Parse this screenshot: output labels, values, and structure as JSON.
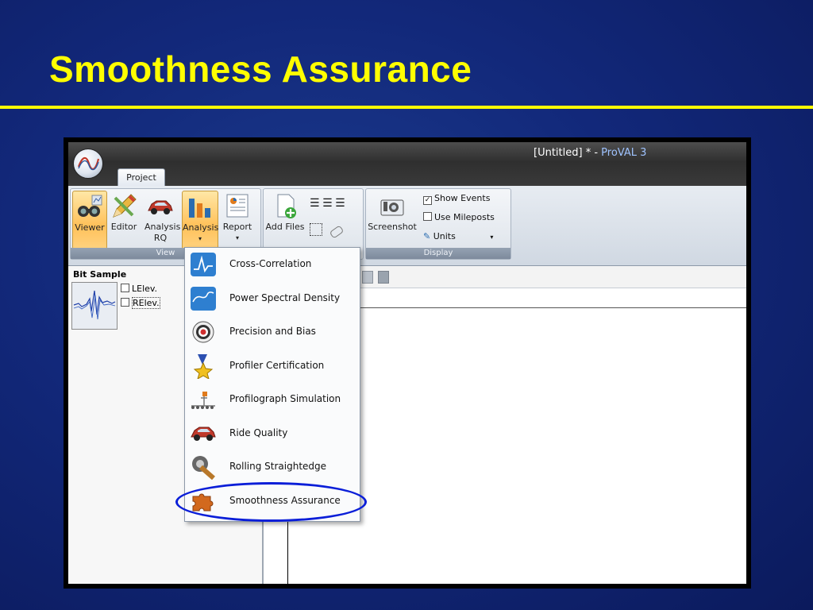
{
  "slide": {
    "title": "Smoothness Assurance"
  },
  "window": {
    "title_prefix": "[Untitled] * - ",
    "app_name": "ProVAL 3"
  },
  "ribbon": {
    "tabs": [
      {
        "label": "Project"
      }
    ],
    "view_group": {
      "label": "View",
      "buttons": [
        {
          "label": "Viewer",
          "icon": "viewer-icon",
          "active": true
        },
        {
          "label": "Editor",
          "icon": "editor-icon"
        },
        {
          "label": "Analysis RQ",
          "icon": "car-icon"
        },
        {
          "label": "Analysis",
          "icon": "bar-chart-icon",
          "dropdown": true,
          "active": true
        },
        {
          "label": "Report",
          "icon": "report-icon",
          "dropdown": true
        }
      ]
    },
    "file_group": {
      "add_files_label": "Add Files"
    },
    "display_group": {
      "label": "Display",
      "screenshot_label": "Screenshot",
      "show_events": {
        "label": "Show Events",
        "checked": true
      },
      "use_mileposts": {
        "label": "Use Mileposts",
        "checked": false
      },
      "units_label": "Units"
    }
  },
  "left_panel": {
    "title": "Bit Sample",
    "checks": [
      {
        "label": "LElev.",
        "checked": false
      },
      {
        "label": "RElev.",
        "checked": false
      }
    ]
  },
  "analysis_menu": {
    "items": [
      {
        "label": "Cross-Correlation",
        "icon": "cross-correlation-icon"
      },
      {
        "label": "Power Spectral Density",
        "icon": "psd-icon"
      },
      {
        "label": "Precision and Bias",
        "icon": "target-icon"
      },
      {
        "label": "Profiler Certification",
        "icon": "medal-icon"
      },
      {
        "label": "Profilograph Simulation",
        "icon": "profilograph-icon"
      },
      {
        "label": "Ride Quality",
        "icon": "car-icon"
      },
      {
        "label": "Rolling Straightedge",
        "icon": "straightedge-icon"
      },
      {
        "label": "Smoothness Assurance",
        "icon": "puzzle-icon",
        "highlighted": true
      }
    ]
  },
  "colors": {
    "title": "#ffff00",
    "highlight_ring": "#0a1ed8",
    "active_button": "#ffc15a"
  }
}
